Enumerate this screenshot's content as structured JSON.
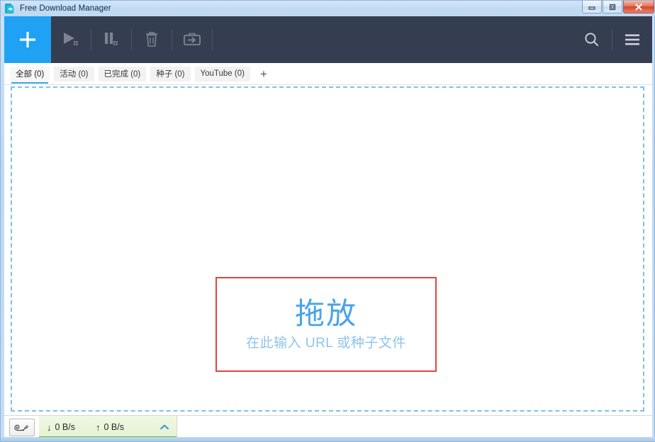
{
  "window": {
    "title": "Free Download Manager",
    "app_icon": "download-arrow-icon",
    "controls": {
      "minimize": "minimize-button",
      "maximize": "maximize-button",
      "close": "close-button"
    }
  },
  "toolbar": {
    "add_label": "+",
    "add_icon": "plus-icon",
    "buttons": [
      {
        "name": "start-all-downloads",
        "icon": "play-all-icon",
        "enabled": false
      },
      {
        "name": "pause-all-downloads",
        "icon": "pause-all-icon",
        "enabled": false
      },
      {
        "name": "delete-download",
        "icon": "trash-icon",
        "enabled": false
      },
      {
        "name": "move-to-folder",
        "icon": "box-arrow-icon",
        "enabled": false
      }
    ],
    "search_icon": "search-icon",
    "menu_icon": "hamburger-menu-icon"
  },
  "tabs": {
    "items": [
      {
        "label": "全部 (0)",
        "name": "tab-all",
        "active": true
      },
      {
        "label": "活动 (0)",
        "name": "tab-active",
        "active": false
      },
      {
        "label": "已完成 (0)",
        "name": "tab-completed",
        "active": false
      },
      {
        "label": "种子 (0)",
        "name": "tab-torrents",
        "active": false
      },
      {
        "label": "YouTube (0)",
        "name": "tab-youtube",
        "active": false
      }
    ],
    "add_label": "+"
  },
  "drop_zone": {
    "title": "拖放",
    "subtitle": "在此输入 URL 或种子文件"
  },
  "status_bar": {
    "speed_limit_icon": "snail-icon",
    "download_arrow": "↓",
    "download_speed": "0 B/s",
    "upload_arrow": "↑",
    "upload_speed": "0 B/s",
    "expander_icon": "chevron-up-icon"
  },
  "colors": {
    "accent_blue": "#1fa2f3",
    "toolbar_dark": "#353e50",
    "drop_border_red": "#e0453e",
    "drop_text_blue": "#4aa3e8",
    "drop_subtext_blue": "#8fc4ea",
    "dashed_border_blue": "#7cc0ec",
    "status_green": "#5fc223",
    "title_bar_blue": "#c2dbf3"
  }
}
